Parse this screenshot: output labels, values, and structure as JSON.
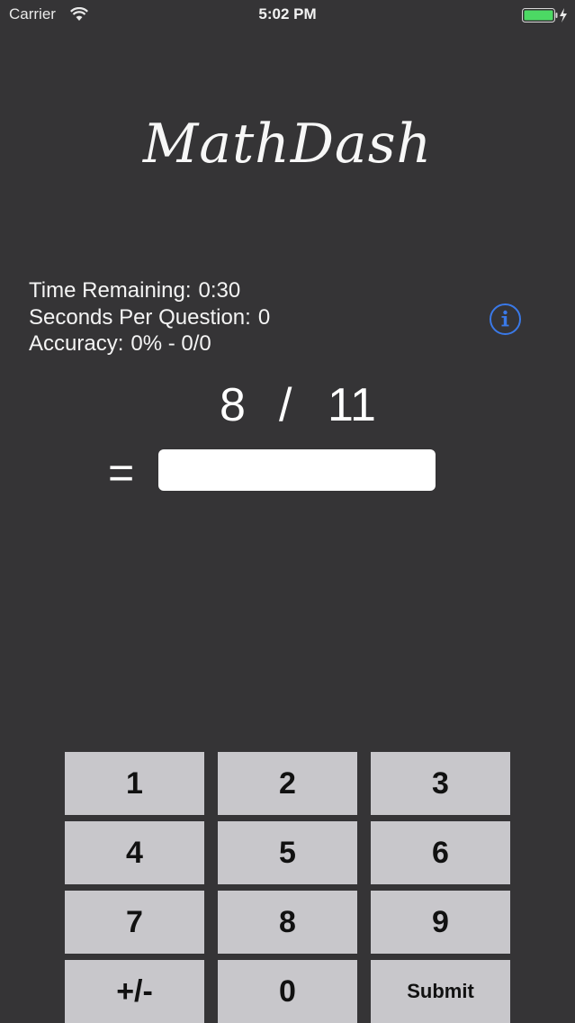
{
  "status_bar": {
    "carrier": "Carrier",
    "time": "5:02 PM",
    "icons": [
      "wifi-icon",
      "battery-icon",
      "charging-bolt-icon"
    ],
    "battery_color": "#4cd964"
  },
  "app": {
    "title": "MathDash"
  },
  "stats": {
    "time_remaining_label": "Time Remaining:",
    "time_remaining_value": "0:30",
    "seconds_per_question_label": "Seconds Per Question:",
    "seconds_per_question_value": "0",
    "accuracy_label": "Accuracy:",
    "accuracy_value": "0% - 0/0"
  },
  "info_button": {
    "icon": "info-icon",
    "glyph": "i",
    "color": "#3a79e8"
  },
  "question": {
    "operand_a": "8",
    "operator": "/",
    "operand_b": "11",
    "equals": "="
  },
  "answer": {
    "value": "",
    "placeholder": ""
  },
  "keypad": {
    "rows": [
      [
        "1",
        "2",
        "3"
      ],
      [
        "4",
        "5",
        "6"
      ],
      [
        "7",
        "8",
        "9"
      ],
      [
        "+/-",
        "0",
        "Submit"
      ]
    ]
  },
  "colors": {
    "background": "#353436",
    "key_background": "#c8c7cb",
    "accent": "#3a79e8"
  }
}
